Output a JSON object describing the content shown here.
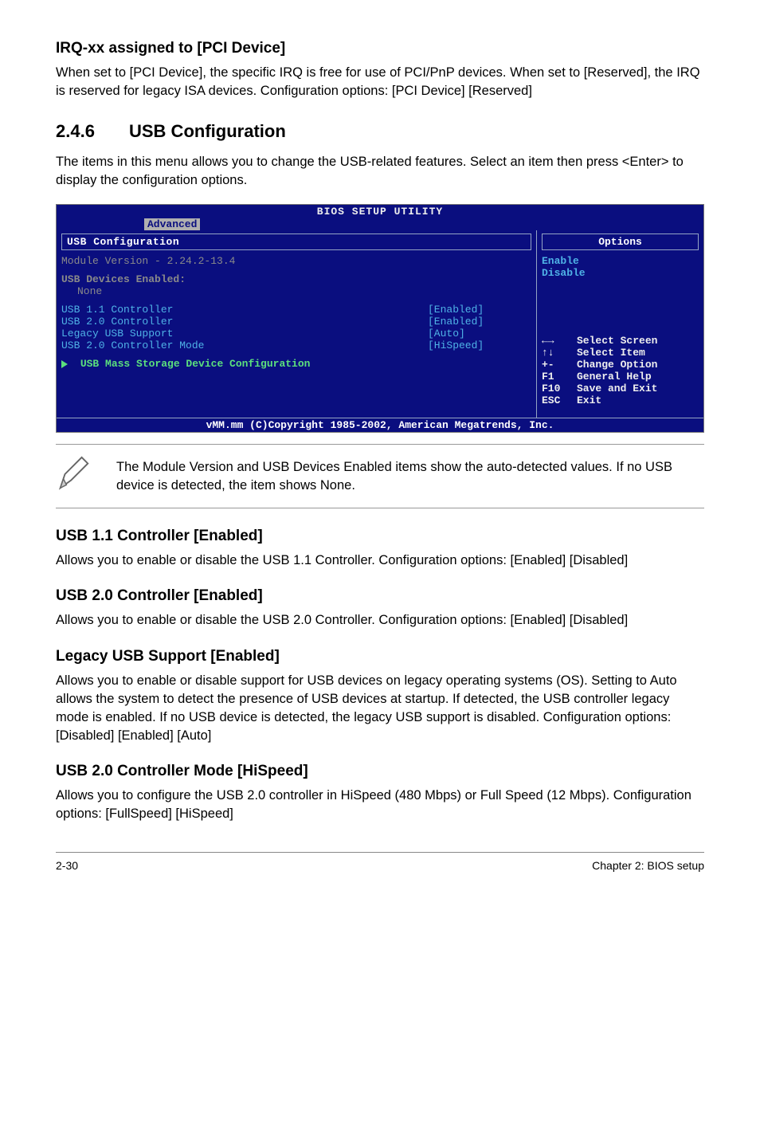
{
  "sections": {
    "irq": {
      "heading": "IRQ-xx assigned to [PCI Device]",
      "p1": "When set to [PCI Device], the specific IRQ is free for use of PCI/PnP devices. When set to [Reserved], the IRQ is reserved for legacy ISA devices. Configuration options: [PCI Device] [Reserved]"
    },
    "usbcfg": {
      "num": "2.4.6",
      "title": "USB Configuration",
      "intro": "The items in this menu allows you to change the USB-related features. Select an item then press <Enter> to display the configuration options."
    },
    "usb11": {
      "heading": "USB 1.1 Controller [Enabled]",
      "body": "Allows you to enable or disable the USB 1.1 Controller. Configuration options: [Enabled] [Disabled]"
    },
    "usb20": {
      "heading": "USB 2.0 Controller [Enabled]",
      "body": "Allows you to enable or disable the USB 2.0 Controller. Configuration options: [Enabled] [Disabled]"
    },
    "legacy": {
      "heading": "Legacy USB Support [Enabled]",
      "body": "Allows you to enable or disable support for USB devices on legacy operating systems (OS). Setting to Auto allows the system to detect the presence of USB devices at startup. If detected, the USB controller legacy mode is enabled. If no USB device is detected, the legacy USB support is disabled. Configuration options: [Disabled] [Enabled] [Auto]"
    },
    "mode": {
      "heading": "USB 2.0 Controller Mode [HiSpeed]",
      "body": "Allows you to configure the USB 2.0 controller in HiSpeed (480 Mbps) or Full Speed (12 Mbps). Configuration options: [FullSpeed] [HiSpeed]"
    }
  },
  "bios": {
    "title": "BIOS SETUP UTILITY",
    "tab": "Advanced",
    "panelTitle": "USB Configuration",
    "module": "Module Version - 2.24.2-13.4",
    "devicesLabel": "USB Devices Enabled:",
    "devicesValue": "None",
    "items": [
      {
        "label": "USB 1.1 Controller",
        "value": "[Enabled]"
      },
      {
        "label": "USB 2.0 Controller",
        "value": "[Enabled]"
      },
      {
        "label": "Legacy USB Support",
        "value": "[Auto]"
      },
      {
        "label": "USB 2.0 Controller Mode",
        "value": "[HiSpeed]"
      }
    ],
    "submenu": "USB Mass Storage Device Configuration",
    "optionsTitle": "Options",
    "options": [
      "Enable",
      "Disable"
    ],
    "help": [
      {
        "key": "←→",
        "txt": "Select Screen"
      },
      {
        "key": "↑↓",
        "txt": "Select Item"
      },
      {
        "key": "+-",
        "txt": "Change Option"
      },
      {
        "key": "F1",
        "txt": "General Help"
      },
      {
        "key": "F10",
        "txt": "Save and Exit"
      },
      {
        "key": "ESC",
        "txt": "Exit"
      }
    ],
    "footer": "vMM.mm (C)Copyright 1985-2002, American Megatrends, Inc."
  },
  "note": "The Module Version and USB Devices Enabled items show the auto-detected values. If no USB device is detected, the item shows None.",
  "footer": {
    "left": "2-30",
    "right": "Chapter 2: BIOS setup"
  }
}
